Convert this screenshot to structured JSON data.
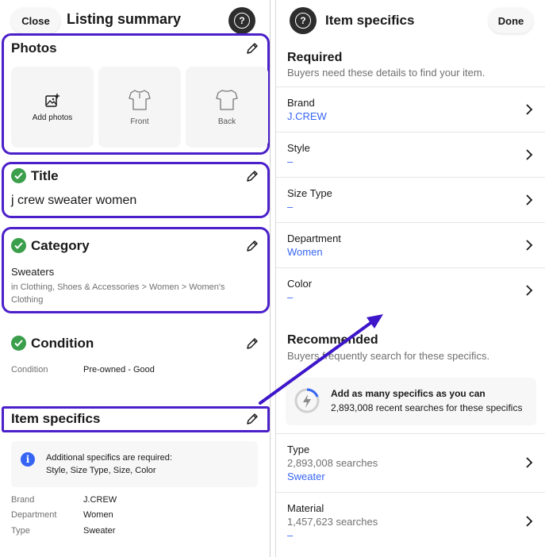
{
  "left": {
    "close_label": "Close",
    "title": "Listing summary",
    "help_glyph": "?",
    "photos": {
      "title": "Photos",
      "tiles": [
        {
          "label": "Add photos",
          "icon": "add-photo-icon"
        },
        {
          "label": "Front",
          "icon": "shirt-front-icon"
        },
        {
          "label": "Back",
          "icon": "shirt-back-icon"
        }
      ]
    },
    "title_section": {
      "heading": "Title",
      "value": "j crew sweater women"
    },
    "category": {
      "heading": "Category",
      "name": "Sweaters",
      "path_line1": "in Clothing, Shoes & Accessories > Women > Women's",
      "path_line2": "Clothing"
    },
    "condition": {
      "heading": "Condition",
      "label": "Condition",
      "value": "Pre-owned - Good"
    },
    "item_specifics": {
      "heading": "Item specifics",
      "notice_line1": "Additional specifics are required:",
      "notice_line2": "Style, Size Type, Size, Color",
      "rows": [
        {
          "label": "Brand",
          "value": "J.CREW"
        },
        {
          "label": "Department",
          "value": "Women"
        },
        {
          "label": "Type",
          "value": "Sweater"
        }
      ]
    }
  },
  "right": {
    "help_glyph": "?",
    "title": "Item specifics",
    "done_label": "Done",
    "required": {
      "heading": "Required",
      "subtitle": "Buyers need these details to find your item.",
      "rows": [
        {
          "label": "Brand",
          "value": "J.CREW"
        },
        {
          "label": "Style",
          "value": "–"
        },
        {
          "label": "Size Type",
          "value": "–"
        },
        {
          "label": "Department",
          "value": "Women"
        },
        {
          "label": "Color",
          "value": "–"
        }
      ]
    },
    "recommended": {
      "heading": "Recommended",
      "subtitle": "Buyers frequently search for these specifics.",
      "promo_title": "Add as many specifics as you can",
      "promo_text": "2,893,008 recent searches for these specifics",
      "rows": [
        {
          "label": "Type",
          "count": "2,893,008 searches",
          "value": "Sweater"
        },
        {
          "label": "Material",
          "count": "1,457,623 searches",
          "value": "–"
        }
      ]
    }
  },
  "colors": {
    "highlight": "#4b1fc9",
    "link_blue": "#3665f3",
    "check_green": "#3a9e4b",
    "arrow": "#3d16c9"
  }
}
